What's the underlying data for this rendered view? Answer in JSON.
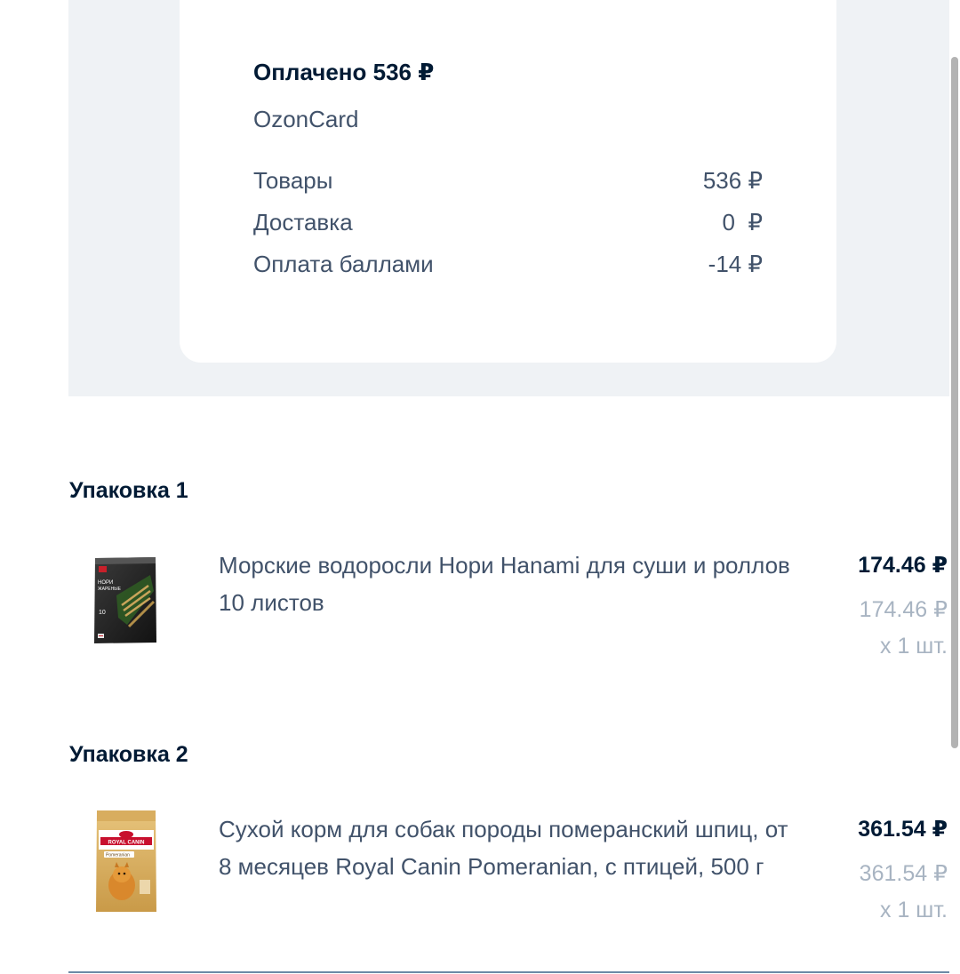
{
  "summary": {
    "paid_title": "Оплачено 536 ₽",
    "payment_method": "OzonCard",
    "rows": [
      {
        "label": "Товары",
        "value": "536 ₽"
      },
      {
        "label": "Доставка",
        "value": "0  ₽"
      },
      {
        "label": "Оплата баллами",
        "value": "-14 ₽"
      }
    ]
  },
  "packages": [
    {
      "title": "Упаковка 1",
      "product": {
        "name": "Морские водоросли Нори Hanami для суши и роллов 10 листов",
        "price": "174.46 ₽",
        "unit_price": "174.46 ₽",
        "quantity": "x 1 шт.",
        "image_icon": "nori-seaweed-pack-icon",
        "image_text": "НОРИ ЖАРЕНЫЕ 10"
      }
    },
    {
      "title": "Упаковка 2",
      "product": {
        "name": "Сухой корм для собак породы померанский шпиц, от 8 месяцев Royal Canin Pomeranian, с птицей, 500 г",
        "price": "361.54 ₽",
        "unit_price": "361.54 ₽",
        "quantity": "x 1 шт.",
        "image_icon": "royal-canin-bag-icon",
        "image_text": "ROYAL CANIN Pomeranian"
      }
    }
  ],
  "colors": {
    "background": "#ffffff",
    "summary_band": "#eff2f5",
    "primary_text": "#001a34",
    "secondary_text": "#41526a",
    "muted_text": "#a8b4c2",
    "divider": "#6c8aa6"
  }
}
